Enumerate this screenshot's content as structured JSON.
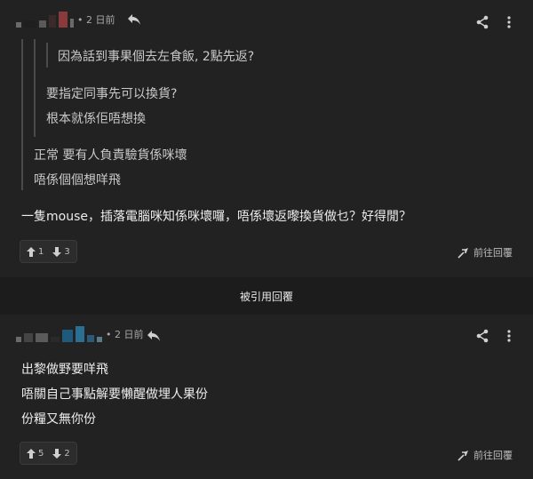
{
  "post1": {
    "time": "2 日前",
    "quote_nested": "因為話到事果個去左食飯, 2點先返?",
    "quote_lines_a": [
      "要指定同事先可以換貨?",
      "根本就係佢唔想換"
    ],
    "quote_lines_b": [
      "正常 要有人負責驗貨係咪壞",
      "唔係個個想咩飛"
    ],
    "body": "一隻mouse，插落電腦咪知係咪壞囉，唔係壞返嚟換貨做乜？好得閒？",
    "upvotes": "1",
    "downvotes": "3",
    "goto_label": "前往回覆"
  },
  "divider": {
    "label": "被引用回覆"
  },
  "post2": {
    "time": "2 日前",
    "lines": [
      "出黎做野要咩飛",
      "唔關自己事點解要懶醒做埋人果份",
      "份糧又無你份"
    ],
    "upvotes": "5",
    "downvotes": "2",
    "goto_label": "前往回覆"
  }
}
